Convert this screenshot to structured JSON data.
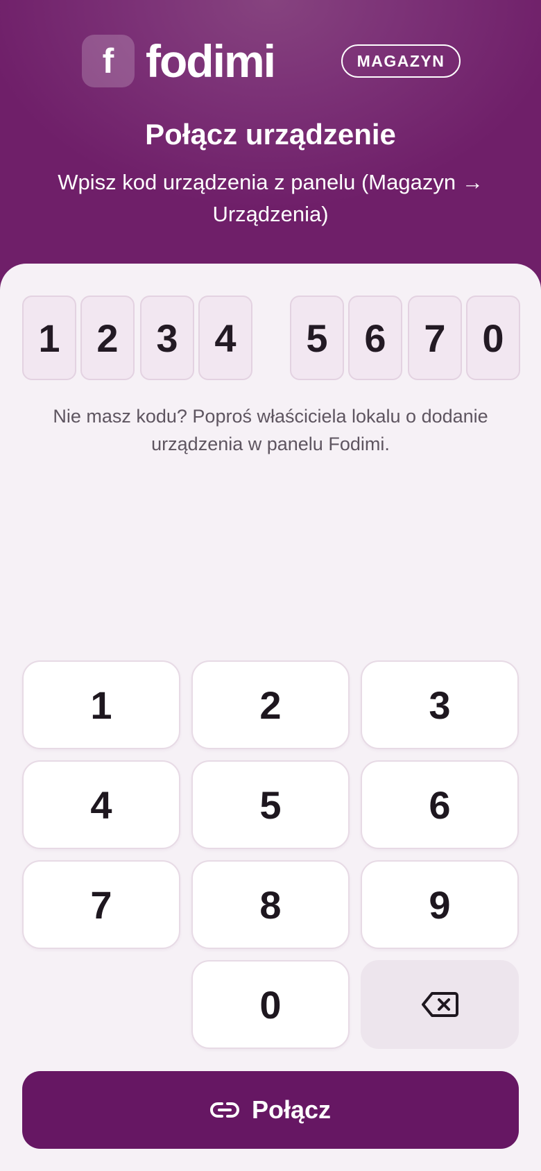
{
  "brand": {
    "logo_letter": "f",
    "name": "fodimi",
    "role_badge": "MAGAZYN"
  },
  "header": {
    "title": "Połącz urządzenie",
    "subtitle": "Wpisz kod urządzenia z panelu (Magazyn → Urządzenia)"
  },
  "code": {
    "digits": [
      "1",
      "2",
      "3",
      "4",
      "5",
      "6",
      "7",
      "0"
    ]
  },
  "hint": "Nie masz kodu? Poproś właściciela lokalu o dodanie urządzenia w panelu Fodimi.",
  "keypad": {
    "keys": [
      "1",
      "2",
      "3",
      "4",
      "5",
      "6",
      "7",
      "8",
      "9",
      "0"
    ],
    "backspace_icon": "backspace-icon"
  },
  "connect_button": {
    "label": "Połącz",
    "icon": "link-icon"
  },
  "colors": {
    "brand_primary": "#661763",
    "header_gradient": "#7c3277",
    "background": "#f6f1f6",
    "code_box": "#f2e7f1"
  }
}
